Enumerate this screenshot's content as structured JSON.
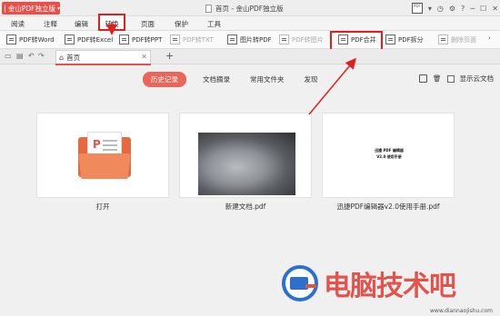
{
  "app": {
    "brand": "金山PDF独立版",
    "window_title": "首页 - 金山PDF独立版"
  },
  "menu": {
    "items": [
      "阅读",
      "注释",
      "编辑",
      "转换",
      "页面",
      "保护",
      "工具"
    ],
    "active": "转换"
  },
  "toolbar": {
    "items": [
      "PDF转Word",
      "PDF转Excel",
      "PDF转PPT",
      "PDF转TXT",
      "图片转PDF",
      "PDF转图片",
      "PDF合并",
      "PDF拆分",
      "删除页面"
    ]
  },
  "tabs": {
    "home_label": "首页",
    "add": "+"
  },
  "nav": {
    "items": [
      "历史记录",
      "文档摘录",
      "常用文件夹",
      "发现"
    ],
    "active": "历史记录",
    "show_cloud_label": "显示云文档"
  },
  "cards": [
    {
      "label": "打开"
    },
    {
      "label": "新建文档.pdf"
    },
    {
      "label": "迅捷PDF编辑器v2.0使用手册.pdf",
      "doc_line1": "迅捷 PDF 编辑器",
      "doc_line2": "V2.0 使用手册"
    }
  ],
  "watermark": {
    "text": "电脑技术吧",
    "small": "www.diannaojishu.com"
  },
  "colors": {
    "accent": "#e8504a",
    "highlight": "#e02020"
  }
}
